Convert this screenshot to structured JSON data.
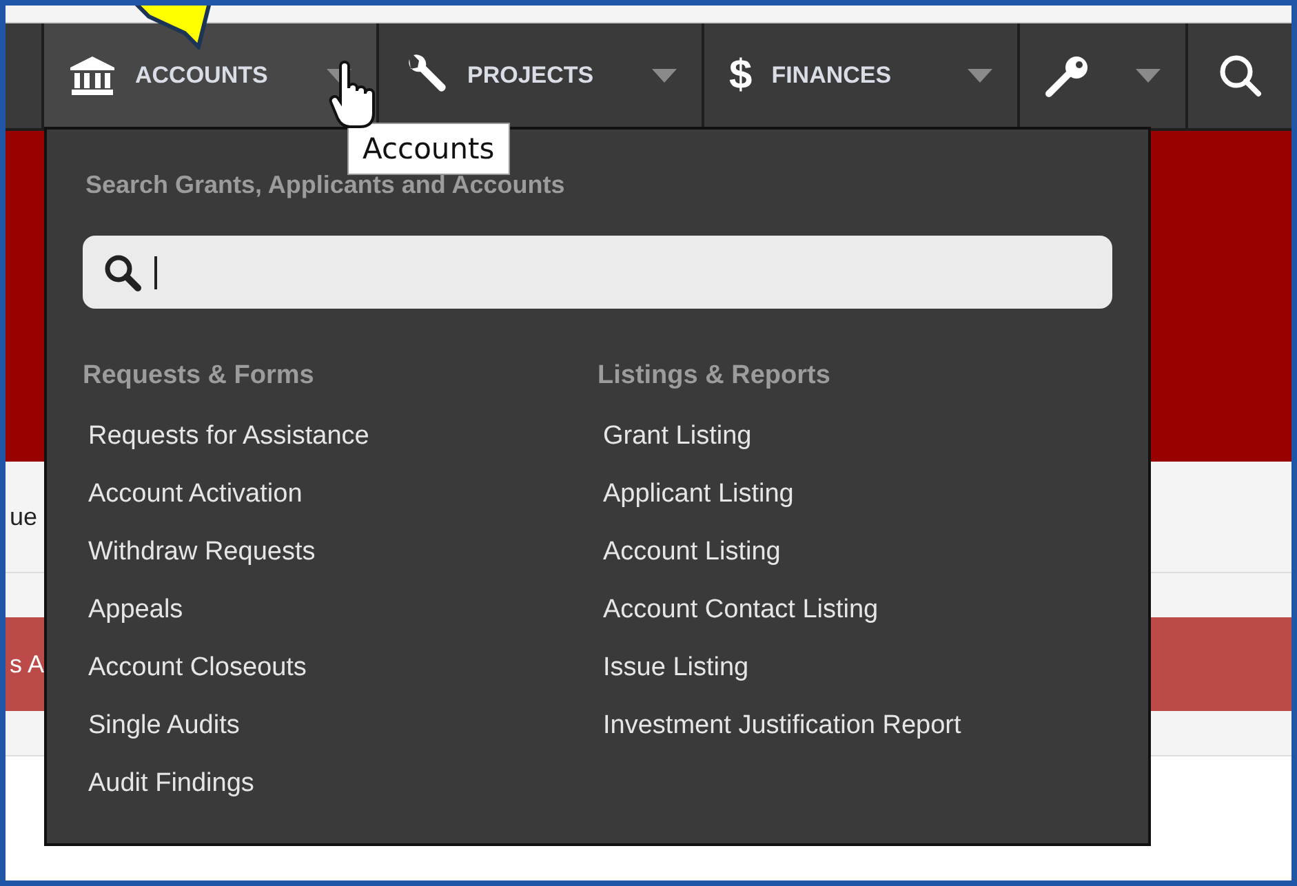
{
  "navbar": {
    "tabs": [
      {
        "kind": "bank",
        "label": "ACCOUNTS",
        "caret": true,
        "selected": true
      },
      {
        "kind": "wrench",
        "label": "PROJECTS",
        "caret": true,
        "selected": false
      },
      {
        "kind": "dollar",
        "glyph": "$",
        "label": "FINANCES",
        "caret": true,
        "selected": false
      },
      {
        "kind": "key",
        "caret": true,
        "selected": false
      },
      {
        "kind": "search",
        "caret": false,
        "selected": false
      }
    ]
  },
  "tooltip": {
    "text": "Accounts"
  },
  "background_page": {
    "fragments": [
      "ue",
      "s A"
    ]
  },
  "dropdown": {
    "search_heading": "Search Grants, Applicants and Accounts",
    "search": {
      "text_cursor": true
    },
    "columns": [
      {
        "heading": "Requests & Forms",
        "items": [
          "Requests for Assistance",
          "Account Activation",
          "Withdraw Requests",
          "Appeals",
          "Account Closeouts",
          "Single Audits",
          "Audit Findings"
        ]
      },
      {
        "heading": "Listings & Reports",
        "items": [
          "Grant Listing",
          "Applicant Listing",
          "Account Listing",
          "Account Contact Listing",
          "Issue Listing",
          "Investment Justification Report"
        ]
      }
    ]
  }
}
